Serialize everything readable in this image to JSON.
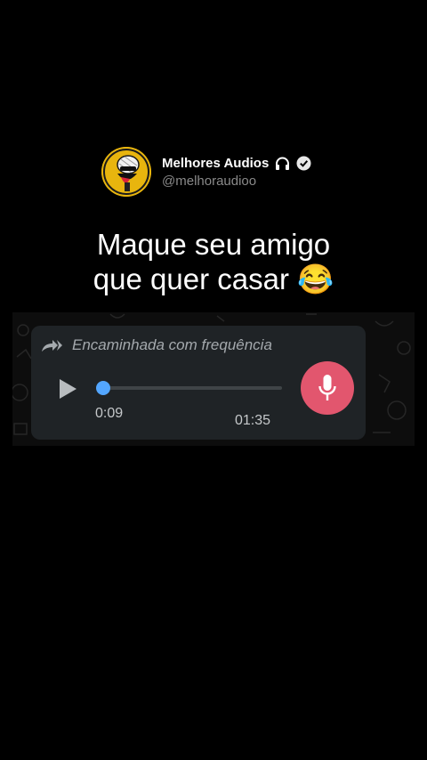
{
  "profile": {
    "name": "Melhores Audios",
    "handle": "@melhoraudioo",
    "avatar_icon": "singing-microphone-mascot-icon",
    "headphones_icon": "headphones-icon",
    "verified_icon": "verified-badge-icon"
  },
  "headline": {
    "line1": "Maque seu amigo",
    "line2": "que quer casar",
    "emoji": "😂"
  },
  "audio_message": {
    "forwarded_label": "Encaminhada com frequência",
    "forward_icon": "double-forward-arrow-icon",
    "play_icon": "play-icon",
    "current_time": "0:09",
    "total_time": "01:35",
    "progress": 0.03,
    "mic_icon": "microphone-icon"
  },
  "colors": {
    "background": "#000000",
    "bubble": "#1f2326",
    "progress_accent": "#53a6ff",
    "mic_button": "#e2566e",
    "avatar_bg": "#e8b50e"
  }
}
